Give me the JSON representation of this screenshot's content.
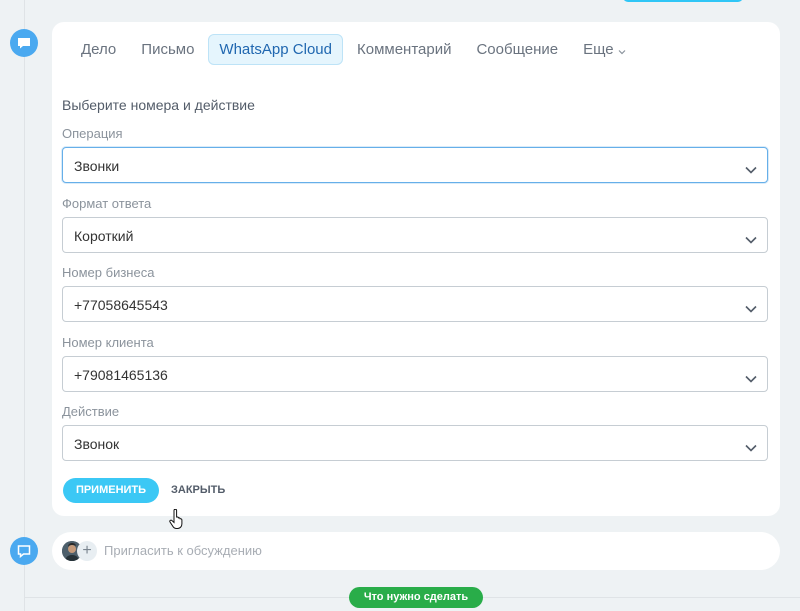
{
  "tabs": [
    {
      "label": "Дело"
    },
    {
      "label": "Письмо"
    },
    {
      "label": "WhatsApp Cloud",
      "active": true
    },
    {
      "label": "Комментарий"
    },
    {
      "label": "Сообщение"
    },
    {
      "label": "Еще"
    }
  ],
  "form": {
    "hint": "Выберите номера и действие",
    "fields": [
      {
        "label": "Операция",
        "value": "Звонки"
      },
      {
        "label": "Формат ответа",
        "value": "Короткий"
      },
      {
        "label": "Номер бизнеса",
        "value": "+77058645543"
      },
      {
        "label": "Номер клиента",
        "value": "+79081465136"
      },
      {
        "label": "Действие",
        "value": "Звонок"
      }
    ],
    "apply_label": "ПРИМЕНИТЬ",
    "close_label": "ЗАКРЫТЬ"
  },
  "comment": {
    "placeholder": "Пригласить к обсуждению"
  },
  "todo_label": "Что нужно сделать",
  "colors": {
    "accent": "#3bc8f5",
    "active_tab_text": "#2067b0",
    "todo_green": "#29ad49",
    "timeline_icon": "#4aa9f0"
  }
}
